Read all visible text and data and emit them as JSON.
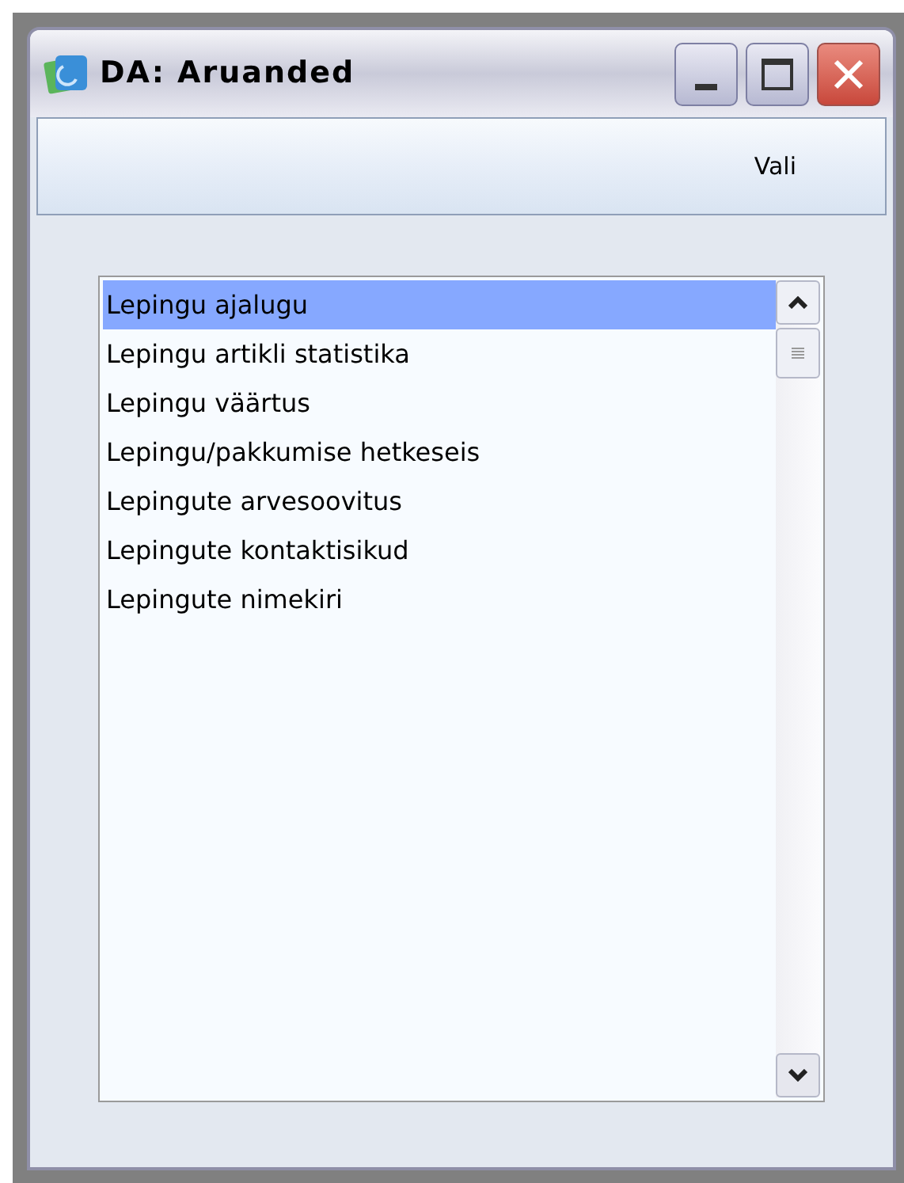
{
  "window": {
    "title": "DA: Aruanded"
  },
  "toolbar": {
    "button": "Vali"
  },
  "list": {
    "items": [
      {
        "label": "Lepingu ajalugu",
        "selected": true
      },
      {
        "label": "Lepingu artikli statistika",
        "selected": false
      },
      {
        "label": "Lepingu väärtus",
        "selected": false
      },
      {
        "label": "Lepingu/pakkumise hetkeseis",
        "selected": false
      },
      {
        "label": "Lepingute arvesoovitus",
        "selected": false
      },
      {
        "label": "Lepingute kontaktisikud",
        "selected": false
      },
      {
        "label": "Lepingute nimekiri",
        "selected": false
      }
    ]
  }
}
